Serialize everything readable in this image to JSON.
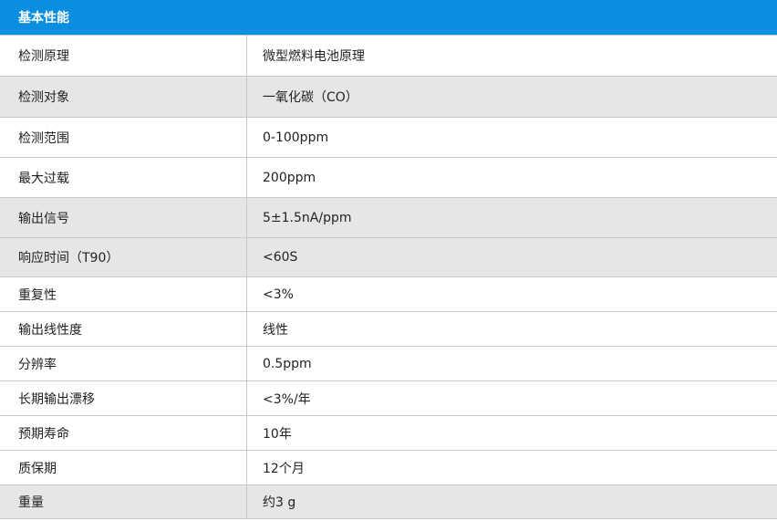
{
  "header": {
    "title": "基本性能"
  },
  "rows": [
    {
      "label": "检测原理",
      "value": "微型燃料电池原理"
    },
    {
      "label": "检测对象",
      "value": "一氧化碳（CO）"
    },
    {
      "label": "检测范围",
      "value": "0-100ppm"
    },
    {
      "label": "最大过载",
      "value": "200ppm"
    },
    {
      "label": "输出信号",
      "value": "5±1.5nA/ppm"
    },
    {
      "label": "响应时间（T90）",
      "value": "<60S"
    },
    {
      "label": "重复性",
      "value": "<3%"
    },
    {
      "label": "输出线性度",
      "value": "线性"
    },
    {
      "label": "分辨率",
      "value": "0.5ppm"
    },
    {
      "label": "长期输出漂移",
      "value": "<3%/年"
    },
    {
      "label": "预期寿命",
      "value": "10年"
    },
    {
      "label": "质保期",
      "value": "12个月"
    },
    {
      "label": "重量",
      "value": "约3 g"
    }
  ],
  "colors": {
    "header_bg": "#0a8fe0",
    "shaded_row": "#e6e6e6",
    "border": "#c9c9c9"
  }
}
